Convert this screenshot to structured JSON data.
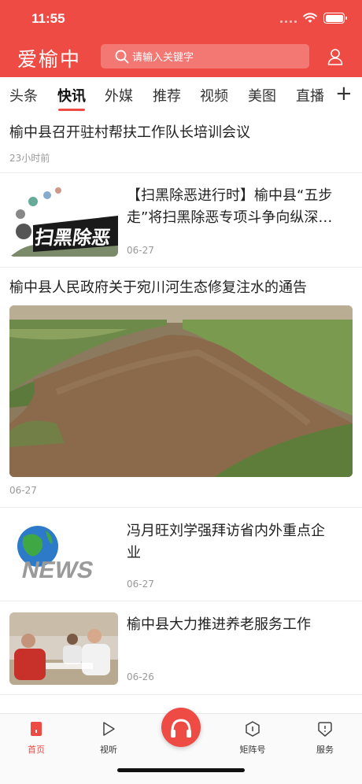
{
  "status": {
    "time": "11:55"
  },
  "header": {
    "logo": "爱榆中",
    "search_placeholder": "请输入关键字"
  },
  "tabs": [
    {
      "label": "头条"
    },
    {
      "label": "快讯",
      "active": true
    },
    {
      "label": "外媒"
    },
    {
      "label": "推荐"
    },
    {
      "label": "视频"
    },
    {
      "label": "美图"
    },
    {
      "label": "直播"
    }
  ],
  "feed": [
    {
      "title": "榆中县召开驻村帮扶工作队长培训会议",
      "meta": "23小时前"
    },
    {
      "title": "【扫黑除恶进行时】榆中县“五步走”将扫黑除恶专项斗争向纵深…",
      "meta": "06-27",
      "thumb_text": "扫黑除恶"
    },
    {
      "title": "榆中县人民政府关于宛川河生态修复注水的通告",
      "meta": "06-27"
    },
    {
      "title": "冯月旺刘学强拜访省内外重点企业",
      "meta": "06-27",
      "thumb_text": "NEWS"
    },
    {
      "title": "榆中县大力推进养老服务工作",
      "meta": "06-26"
    }
  ],
  "tabbar": [
    {
      "label": "首页",
      "icon": "home-icon",
      "active": true
    },
    {
      "label": "视听",
      "icon": "play-icon"
    },
    {
      "label": "",
      "icon": "headphones-icon"
    },
    {
      "label": "矩阵号",
      "icon": "hexagon-icon"
    },
    {
      "label": "服务",
      "icon": "service-icon"
    }
  ],
  "colors": {
    "brand": "#ef4b45",
    "meta": "#999999"
  }
}
